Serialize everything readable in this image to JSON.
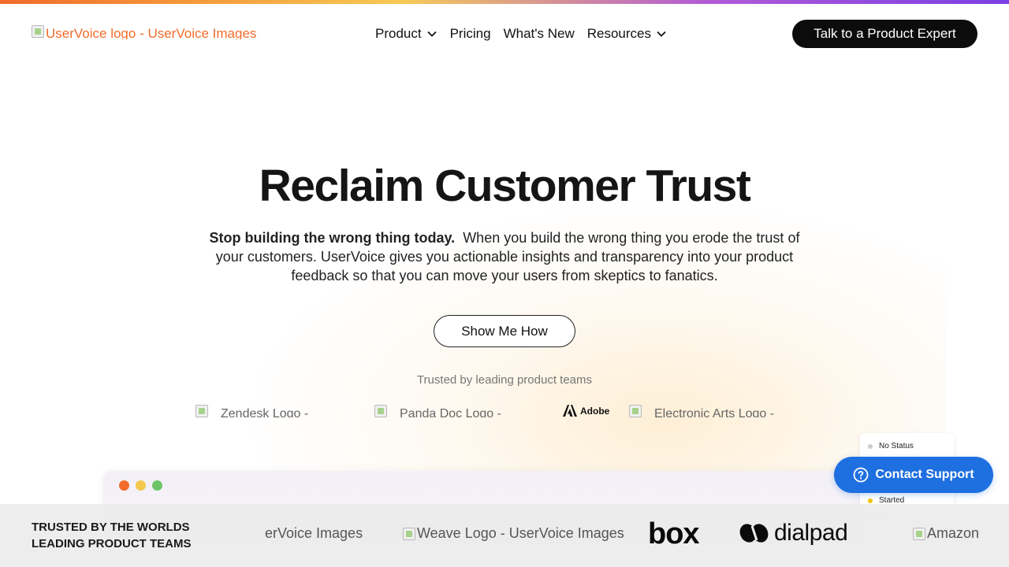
{
  "header": {
    "logo_alt": "UserVoice logo - UserVoice Images",
    "nav": [
      {
        "label": "Product",
        "has_dropdown": true
      },
      {
        "label": "Pricing",
        "has_dropdown": false
      },
      {
        "label": "What's New",
        "has_dropdown": false
      },
      {
        "label": "Resources",
        "has_dropdown": true
      }
    ],
    "cta_label": "Talk to a Product Expert"
  },
  "hero": {
    "title": "Reclaim Customer Trust",
    "subtitle_bold": "Stop building the wrong thing today.",
    "subtitle_rest": "When you build the wrong thing you erode the trust of your customers.  UserVoice gives you actionable insights and transparency into your product feedback so that you can move your users from skeptics to fanatics.",
    "button_label": "Show Me How",
    "trusted_label": "Trusted by leading product teams"
  },
  "customer_logos": [
    {
      "alt": "Zendesk Logo - "
    },
    {
      "alt": "Panda Doc Logo - "
    },
    {
      "name": "Adobe"
    },
    {
      "alt": "Electronic Arts Logo - "
    }
  ],
  "status_card": {
    "items": [
      {
        "label": "No Status",
        "color": "#cccccc"
      },
      {
        "label": "Started",
        "color": "#f2c200"
      }
    ]
  },
  "contact_support": {
    "label": "Contact Support"
  },
  "footer": {
    "title_line1": "TRUSTED BY THE WORLDS",
    "title_line2": "LEADING PRODUCT TEAMS",
    "logos": [
      {
        "alt": "erVoice Images"
      },
      {
        "alt": "Weave Logo - UserVoice Images"
      },
      {
        "name": "box"
      },
      {
        "name": "dialpad"
      },
      {
        "alt": "Amazon"
      }
    ]
  },
  "colors": {
    "brand_orange": "#f26b2a",
    "contact_blue": "#1e6fe0",
    "cta_black": "#0c0c0c"
  }
}
